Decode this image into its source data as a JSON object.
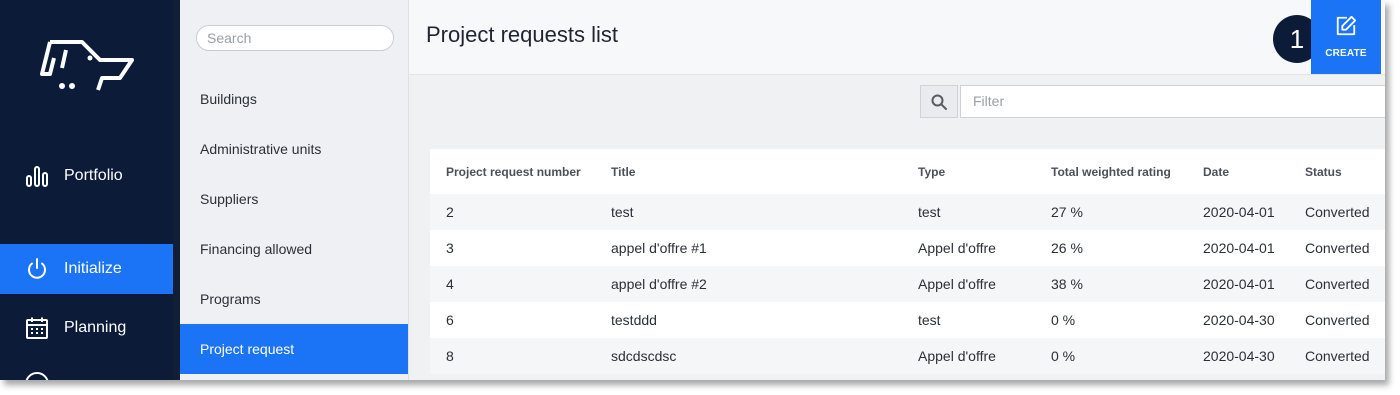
{
  "nav": {
    "items": [
      {
        "label": "Portfolio",
        "icon": "bar-chart-icon",
        "active": false
      },
      {
        "label": "Initialize",
        "icon": "power-icon",
        "active": true
      },
      {
        "label": "Planning",
        "icon": "calendar-icon",
        "active": false
      }
    ]
  },
  "submenu": {
    "search_placeholder": "Search",
    "items": [
      {
        "label": "Buildings"
      },
      {
        "label": "Administrative units"
      },
      {
        "label": "Suppliers"
      },
      {
        "label": "Financing allowed"
      },
      {
        "label": "Programs"
      },
      {
        "label": "Project request",
        "active": true
      }
    ]
  },
  "header": {
    "title": "Project requests list",
    "create_label": "CREATE",
    "callout_number": "1"
  },
  "filter": {
    "placeholder": "Filter"
  },
  "table": {
    "columns": [
      "Project request number",
      "Title",
      "Type",
      "Total weighted rating",
      "Date",
      "Status"
    ],
    "rows": [
      [
        "2",
        "test",
        "test",
        "27 %",
        "2020-04-01",
        "Converted"
      ],
      [
        "3",
        "appel d'offre #1",
        "Appel d'offre",
        "26 %",
        "2020-04-01",
        "Converted"
      ],
      [
        "4",
        "appel d'offre #2",
        "Appel d'offre",
        "38 %",
        "2020-04-01",
        "Converted"
      ],
      [
        "6",
        "testddd",
        "test",
        "0 %",
        "2020-04-30",
        "Converted"
      ],
      [
        "8",
        "sdcdscdsc",
        "Appel d'offre",
        "0 %",
        "2020-04-30",
        "Converted"
      ]
    ]
  },
  "colors": {
    "accent": "#1b73f5",
    "nav_bg": "#0b1b38",
    "callout_bg": "#0b1b38"
  }
}
